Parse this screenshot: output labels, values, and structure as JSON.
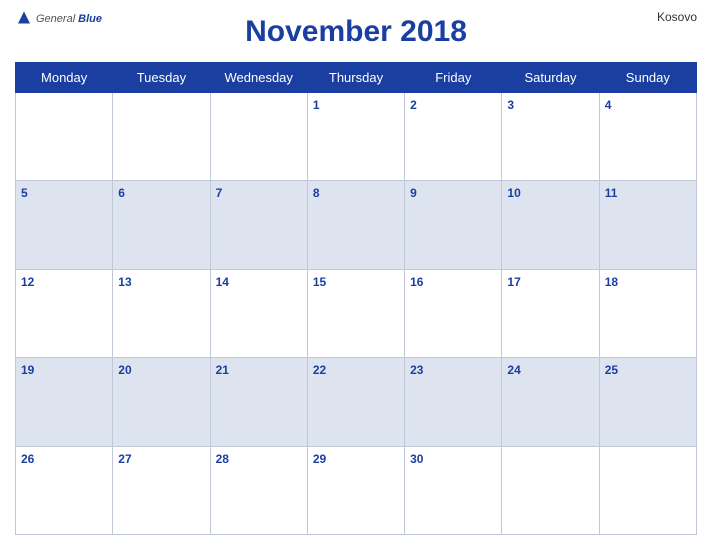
{
  "header": {
    "logo_general": "General",
    "logo_blue": "Blue",
    "title": "November 2018",
    "country": "Kosovo"
  },
  "weekdays": [
    "Monday",
    "Tuesday",
    "Wednesday",
    "Thursday",
    "Friday",
    "Saturday",
    "Sunday"
  ],
  "weeks": [
    [
      "",
      "",
      "",
      "1",
      "2",
      "3",
      "4"
    ],
    [
      "5",
      "6",
      "7",
      "8",
      "9",
      "10",
      "11"
    ],
    [
      "12",
      "13",
      "14",
      "15",
      "16",
      "17",
      "18"
    ],
    [
      "19",
      "20",
      "21",
      "22",
      "23",
      "24",
      "25"
    ],
    [
      "26",
      "27",
      "28",
      "29",
      "30",
      "",
      ""
    ]
  ]
}
